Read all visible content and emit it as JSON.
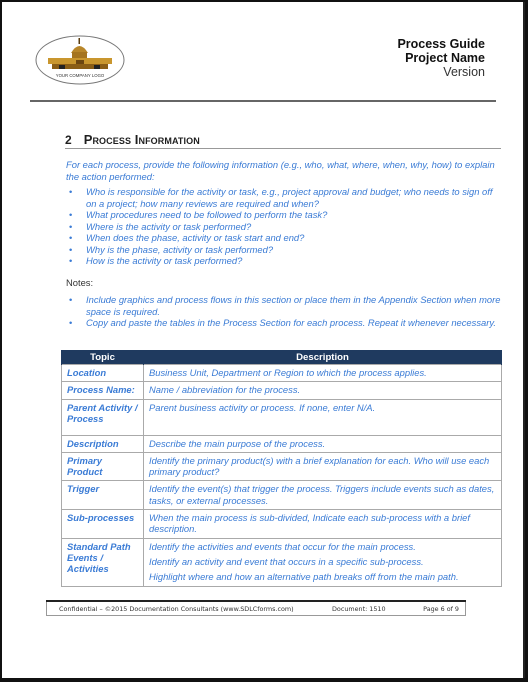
{
  "header": {
    "logo_text": "YOUR COMPANY LOGO",
    "title": "Process Guide",
    "project": "Project Name",
    "version": "Version"
  },
  "section": {
    "number": "2",
    "title": "Process Information",
    "intro": "For each process, provide the following information (e.g., who, what, where, when, why, how) to explain the action performed:",
    "questions": [
      "Who is responsible for the activity or task, e.g., project approval and budget; who needs to sign off on a project; how many reviews are required and when?",
      "What procedures need to be followed to perform the task?",
      "Where is the activity or task performed?",
      "When does the phase, activity or task start and end?",
      "Why is the phase, activity or task performed?",
      "How is the activity or task performed?"
    ],
    "notes_label": "Notes:",
    "notes": [
      "Include graphics and process flows in this section or place them in the Appendix Section when more space is required.",
      "Copy and paste the tables in the Process Section for each process. Repeat it whenever necessary."
    ]
  },
  "table": {
    "headers": [
      "Topic",
      "Description"
    ],
    "rows": [
      {
        "topic": "Location",
        "desc": [
          "Business Unit, Department or Region to which the process applies."
        ]
      },
      {
        "topic": "Process Name:",
        "desc": [
          "Name / abbreviation for the process."
        ]
      },
      {
        "topic": "Parent Activity / Process",
        "desc": [
          "Parent business activity or process. If none, enter N/A."
        ]
      },
      {
        "topic": "Description",
        "desc": [
          "Describe the main purpose of the process."
        ]
      },
      {
        "topic": "Primary Product",
        "desc": [
          "Identify the primary product(s) with a brief explanation for each. Who will use each primary product?"
        ]
      },
      {
        "topic": "Trigger",
        "desc": [
          "Identify the event(s) that trigger the process. Triggers include events such as dates, tasks, or external processes."
        ]
      },
      {
        "topic": "Sub-processes",
        "desc": [
          "When the main process is sub-divided, Indicate each sub-process with a brief description."
        ]
      },
      {
        "topic": "Standard Path Events / Activities",
        "desc": [
          "Identify the activities and events that occur for the main process.",
          "Identify an activity and event that occurs in a specific sub-process.",
          "Highlight where and how an alternative path breaks off from the main path."
        ]
      }
    ]
  },
  "footer": {
    "confidential": "Confidential – ©2015 Documentation Consultants (www.SDLCforms.com)",
    "document": "Document: 1510",
    "page": "Page 6 of 9"
  },
  "colors": {
    "accent_text": "#3a7bd5",
    "table_header": "#1f3a5f"
  }
}
